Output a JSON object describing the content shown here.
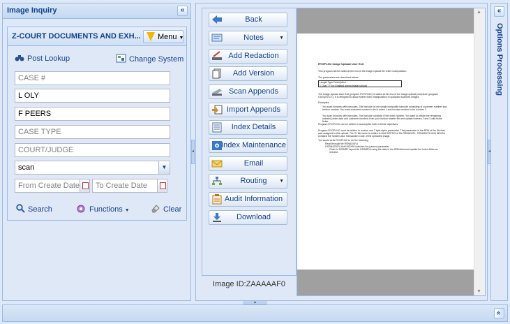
{
  "left_panel": {
    "title": "Image Inquiry",
    "collapse_glyph": "«",
    "court_title": "Z-COURT DOCUMENTS AND EXH...",
    "menu_label": "Menu",
    "post_lookup_label": "Post Lookup",
    "change_system_label": "Change System",
    "fields": [
      {
        "value": "",
        "placeholder": "CASE #"
      },
      {
        "value": "L OLY",
        "placeholder": ""
      },
      {
        "value": "F PEERS",
        "placeholder": ""
      },
      {
        "value": "",
        "placeholder": "CASE TYPE"
      },
      {
        "value": "",
        "placeholder": "COURT/JUDGE"
      }
    ],
    "scan_value": "scan",
    "from_date_placeholder": "From Create Date",
    "to_date_placeholder": "To Create Date",
    "search_label": "Search",
    "functions_label": "Functions",
    "clear_label": "Clear"
  },
  "actions": [
    {
      "label": "Back",
      "icon": "back-arrow-icon",
      "dropdown": false
    },
    {
      "label": "Notes",
      "icon": "notes-icon",
      "dropdown": true
    },
    {
      "label": "Add Redaction",
      "icon": "redaction-icon",
      "dropdown": false
    },
    {
      "label": "Add Version",
      "icon": "version-icon",
      "dropdown": false
    },
    {
      "label": "Scan Appends",
      "icon": "scanner-icon",
      "dropdown": false
    },
    {
      "label": "Import Appends",
      "icon": "import-icon",
      "dropdown": false
    },
    {
      "label": "Index Details",
      "icon": "index-details-icon",
      "dropdown": false
    },
    {
      "label": "Index Maintenance",
      "icon": "index-maintenance-icon",
      "dropdown": false
    },
    {
      "label": "Email",
      "icon": "envelope-icon",
      "dropdown": false
    },
    {
      "label": "Routing",
      "icon": "routing-icon",
      "dropdown": true
    },
    {
      "label": "Audit Information",
      "icon": "audit-icon",
      "dropdown": false
    },
    {
      "label": "Download",
      "icon": "download-icon",
      "dropdown": false
    }
  ],
  "image_id": "Image ID:ZAAAAAF0",
  "document": {
    "heading": "RYGPLNC Image Upload User Exit",
    "intro": "This program will be called at the end of the image Upload file entire manipulation.",
    "params_label": "The parameters are described below:",
    "table_rows": [
      "Length  Type  Description",
      "1       Char  \"Y\" for Enabled during image upload"
    ],
    "para1": "The Image Upload User Exit (program RYGPLNC) is called at the end of the image upload procedure (program OUSQSV171). It is designed to allow further index manipulation of uploaded scanned images.",
    "examples_label": "Examples:",
    "bullets": [
      "You scan invoices with barcodes. The barcode is one single composite barcode consisting of customer number and invoice number. You want customer number to be in index 1 and invoice number to be in index 2.",
      "You scan invoices with barcodes. The barcode consists of the order number. You want to obtain the remaining indexes (order date and customer number) from your invoice master file and update indexes 2 and 3 with those fields."
    ],
    "para2": "Program RYGPLNC can be written to accomplish both of these objectives.",
    "para3": "Program RYGPLNC must be written to receive one 7 byte alpha parameter. That parameter is the RRN of the file that was assigned to this upload. The 'D' file name is written to field INSTNO of file RSNADXFL. RSNADXFU field INDXNI contains the System and Transaction Code of the uploaded image.",
    "para4": "You would write RYGPLNC to do the following:",
    "steps": [
      "Read through file RSNADXFU",
      "If RSNADXFU field INDXNI matches the passed parameter",
      "Chain to RSIMRF layout file RSIMRFA using the data in the RRN field and update the index fields as needed."
    ]
  },
  "right_panel": {
    "title": "Options Processing",
    "collapse_glyph": "«"
  },
  "bottom_panel": {
    "expand_glyph": "»"
  }
}
